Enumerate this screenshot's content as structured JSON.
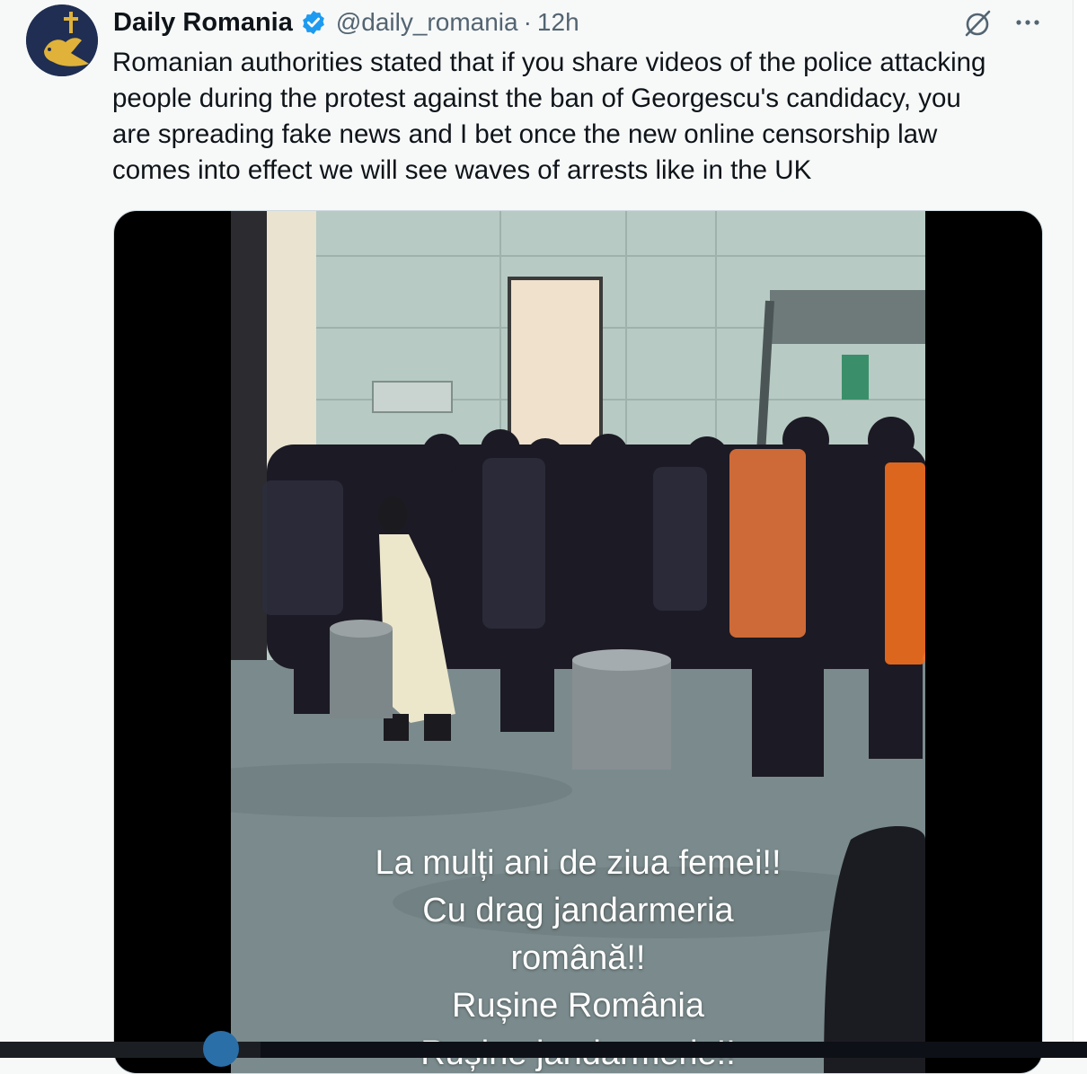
{
  "tweet": {
    "display_name": "Daily Romania",
    "handle": "@daily_romania",
    "separator": "·",
    "timestamp": "12h",
    "text_lines": [
      "Romanian authorities stated that if you share videos of the police attacking",
      "people during the protest against the ban of Georgescu's candidacy, you",
      "are spreading fake news and I bet once the new online censorship law",
      "comes into effect we will see waves of arrests like in the UK"
    ]
  },
  "media": {
    "caption_lines": [
      "La mulți ani de ziua femei!!",
      "Cu drag jandarmeria",
      "română!!",
      "Rușine România",
      "Rușine jandarmerie!!"
    ]
  },
  "icons": {
    "verified": "verified-badge-icon",
    "grok": "grok-icon",
    "more": "more-options-icon"
  },
  "colors": {
    "accent": "#1d9bf0",
    "text_primary": "#0f1419",
    "text_secondary": "#536471",
    "background": "#f7f9f9",
    "orange_shield": "#e86a20"
  }
}
